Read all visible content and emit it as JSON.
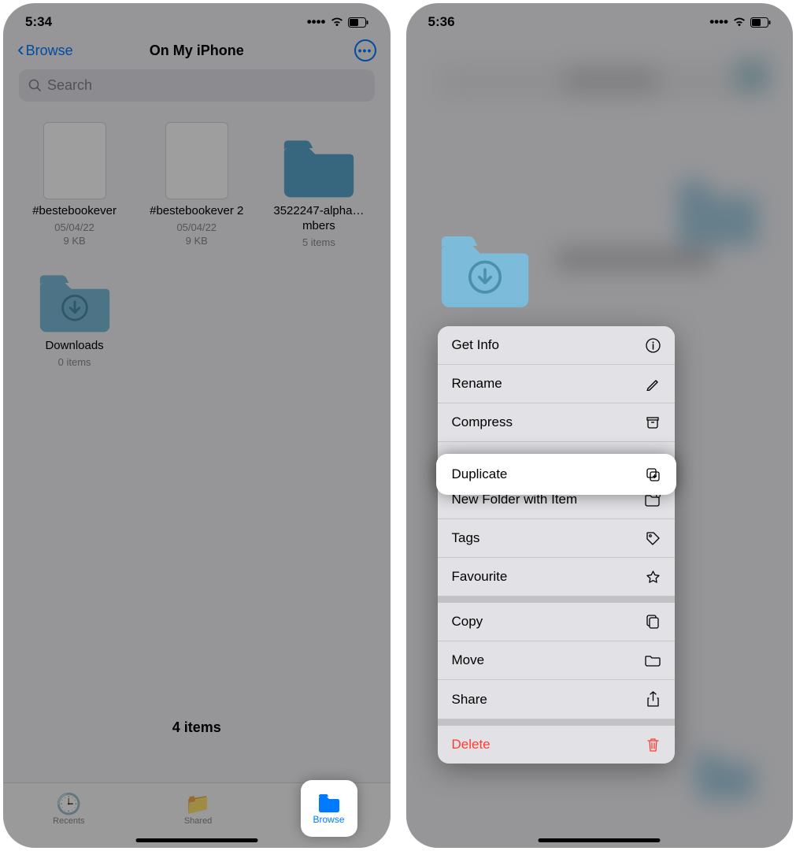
{
  "screen1": {
    "status": {
      "time": "5:34"
    },
    "nav": {
      "back_label": "Browse",
      "title": "On My iPhone"
    },
    "search": {
      "placeholder": "Search"
    },
    "items": [
      {
        "name": "#bestebookever",
        "date": "05/04/22",
        "size": "9 KB",
        "type": "file"
      },
      {
        "name": "#bestebookever 2",
        "date": "05/04/22",
        "size": "9 KB",
        "type": "file"
      },
      {
        "name": "3522247-alpha…mbers",
        "meta": "5 items",
        "type": "folder"
      },
      {
        "name": "Downloads",
        "meta": "0 items",
        "type": "folder"
      }
    ],
    "footer_count": "4 items",
    "tabs": {
      "recents": "Recents",
      "shared": "Shared",
      "browse": "Browse"
    }
  },
  "screen2": {
    "status": {
      "time": "5:36"
    },
    "menu": {
      "get_info": "Get Info",
      "rename": "Rename",
      "compress": "Compress",
      "duplicate": "Duplicate",
      "new_folder": "New Folder with Item",
      "tags": "Tags",
      "favourite": "Favourite",
      "copy": "Copy",
      "move": "Move",
      "share": "Share",
      "delete": "Delete"
    }
  }
}
